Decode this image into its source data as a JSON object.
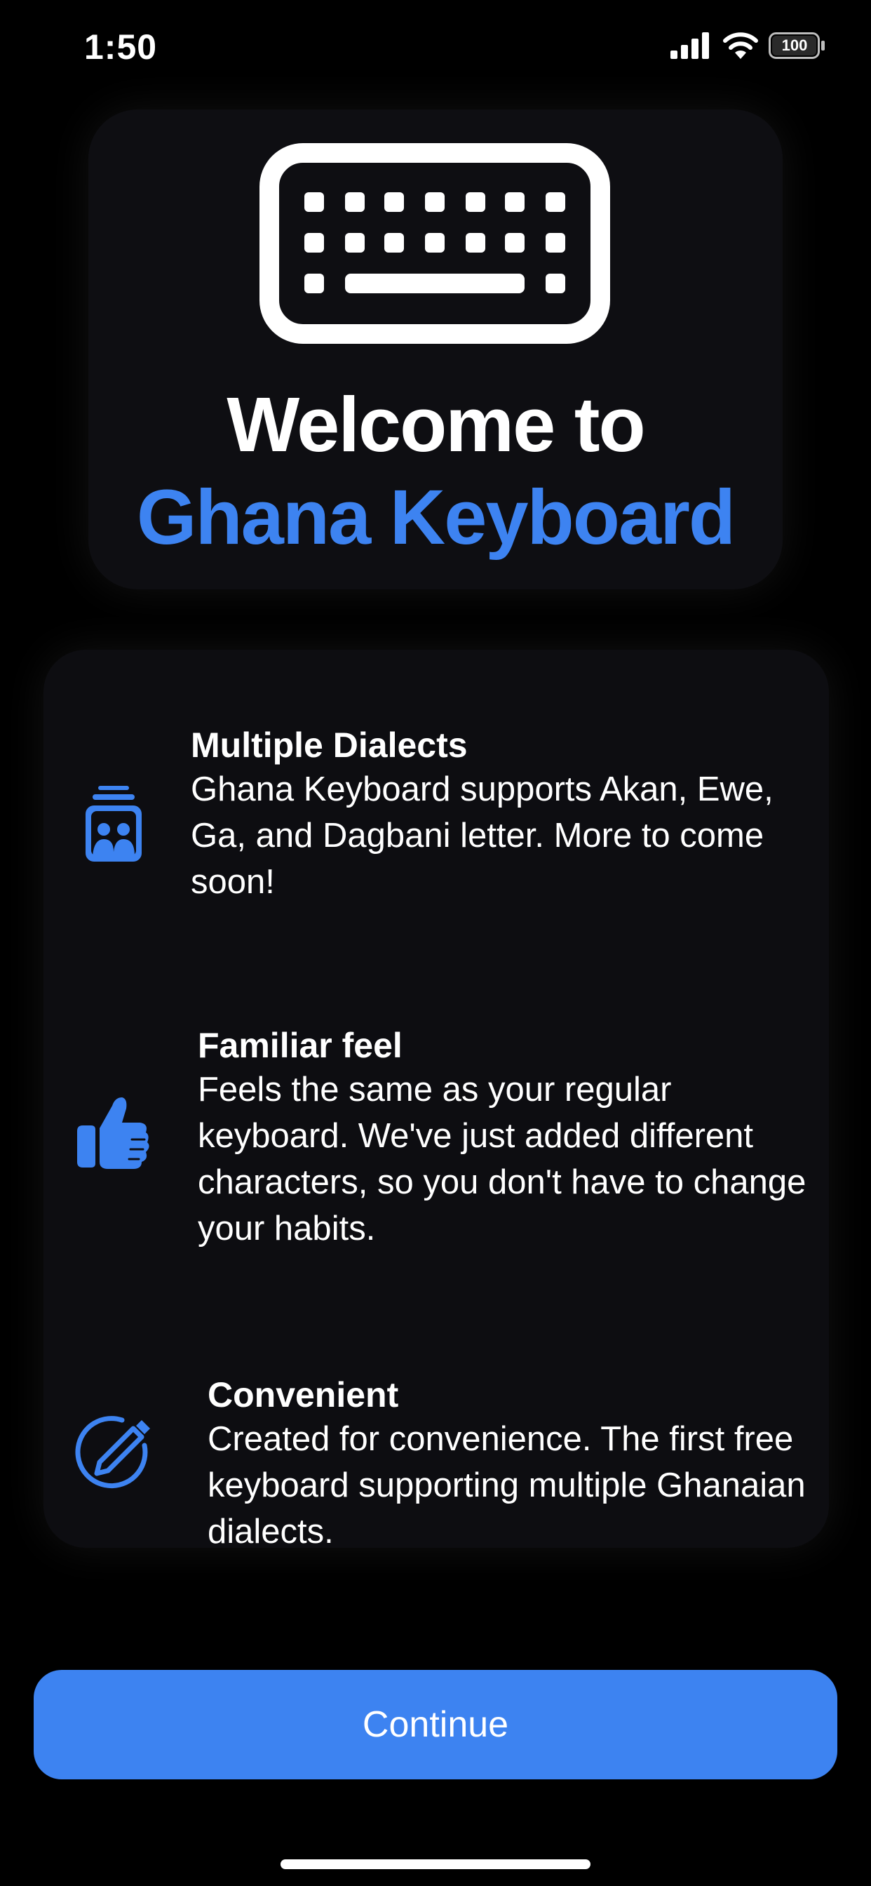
{
  "status_bar": {
    "time": "1:50",
    "battery": "100",
    "icons": [
      "cellular-signal-icon",
      "wifi-icon",
      "battery-icon"
    ]
  },
  "header": {
    "icon": "keyboard-icon",
    "welcome": "Welcome to",
    "app_name": "Ghana Keyboard"
  },
  "features": [
    {
      "icon": "people-frame-icon",
      "title": "Multiple Dialects",
      "description": "Ghana Keyboard supports Akan, Ewe, Ga, and Dagbani letter. More to come soon!"
    },
    {
      "icon": "thumbs-up-icon",
      "title": "Familiar feel",
      "description": "Feels the same as your regular keyboard. We've just added different characters, so you don't have to change your habits."
    },
    {
      "icon": "pencil-circle-icon",
      "title": "Convenient",
      "description": "Created for convenience. The first free keyboard supporting multiple Ghanaian dialects."
    }
  ],
  "continue_label": "Continue",
  "colors": {
    "accent": "#3d83f1",
    "background": "#000000",
    "card": "#0e0e12",
    "text": "#ffffff"
  }
}
